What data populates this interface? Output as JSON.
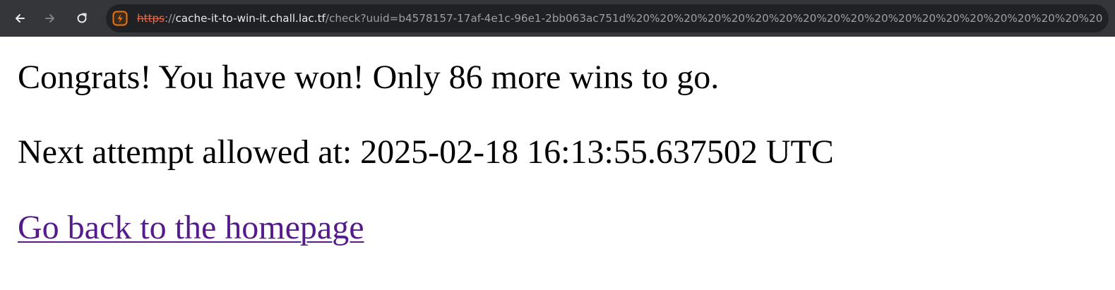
{
  "browser": {
    "url": {
      "scheme": "https",
      "separator": "://",
      "host": "cache-it-to-win-it.chall.lac.tf",
      "path": "/check?uuid=b4578157-17af-4e1c-96e1-2bb063ac751d%20%20%20%20%20%20%20%20%20%20%20%20%20%20%20%20%20%20%20%20"
    },
    "icons": {
      "back": "arrow-left-icon",
      "forward": "arrow-right-icon",
      "reload": "reload-icon",
      "site": "not-secure-site-icon"
    },
    "colors": {
      "toolbar": "#35363a",
      "omnibox": "#202124",
      "insecure_scheme": "#e46c4e"
    }
  },
  "page": {
    "message": "Congrats! You have won! Only 86 more wins to go.",
    "next_attempt": "Next attempt allowed at: 2025-02-18 16:13:55.637502 UTC",
    "homepage_link": "Go back to the homepage",
    "link_color": "#551a8b"
  }
}
